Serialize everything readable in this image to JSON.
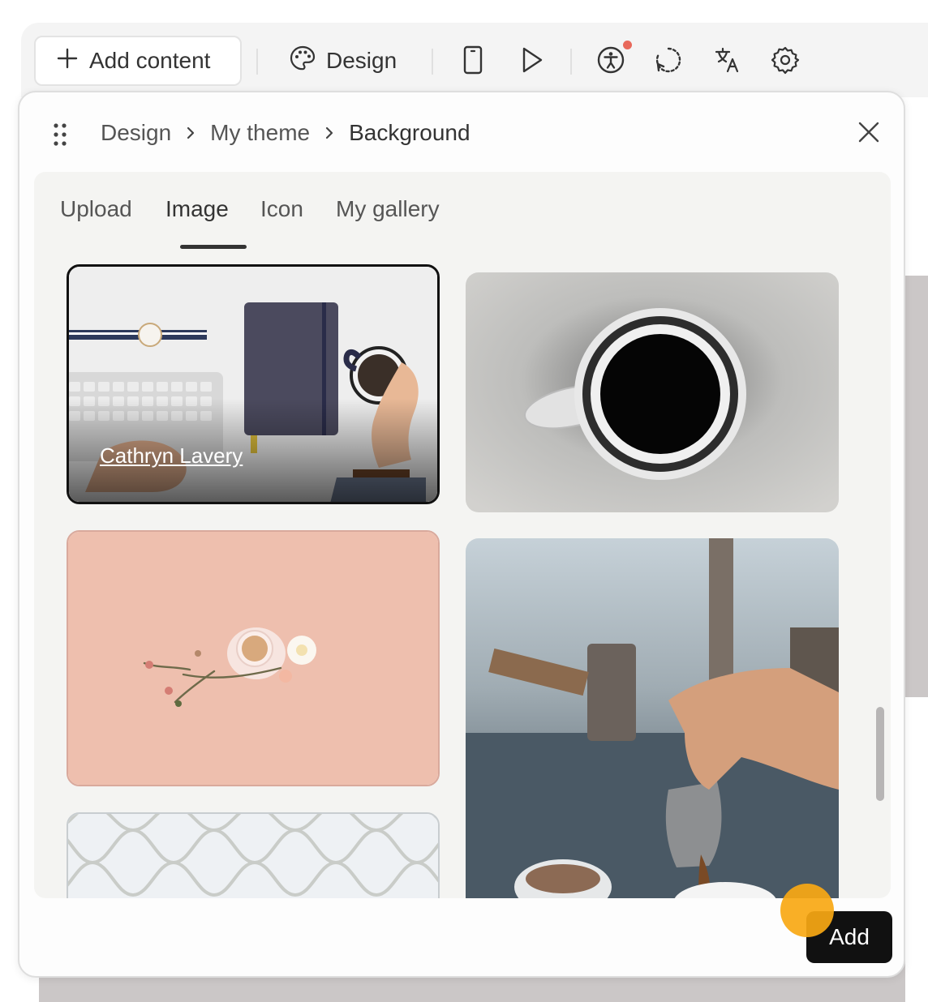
{
  "toolbar": {
    "add_content_label": "Add content",
    "design_label": "Design",
    "icons": [
      "plus-icon",
      "palette-icon",
      "mobile-preview-icon",
      "play-icon",
      "accessibility-icon",
      "refresh-icon",
      "translate-icon",
      "settings-icon"
    ],
    "notification_color": "#e8685a"
  },
  "panel": {
    "breadcrumb": [
      "Design",
      "My theme",
      "Background"
    ],
    "tabs": [
      {
        "label": "Upload"
      },
      {
        "label": "Image"
      },
      {
        "label": "Icon"
      },
      {
        "label": "My gallery"
      }
    ],
    "active_tab": "Image",
    "images": [
      {
        "subject": "workspace-keyboard-notebook-coffee",
        "credit": "Cathryn Lavery",
        "selected": true
      },
      {
        "subject": "black-coffee-mug-top-view",
        "selected": false
      },
      {
        "subject": "tea-cup-flowers-peach-background",
        "selected": false
      },
      {
        "subject": "barista-pouring-coffee",
        "selected": false
      },
      {
        "subject": "white-arabesque-tiles",
        "selected": false
      }
    ],
    "add_button_label": "Add"
  },
  "colors": {
    "accent_dark": "#111111",
    "panel_bg": "#f4f4f2",
    "cursor_highlight": "#f9a814"
  }
}
